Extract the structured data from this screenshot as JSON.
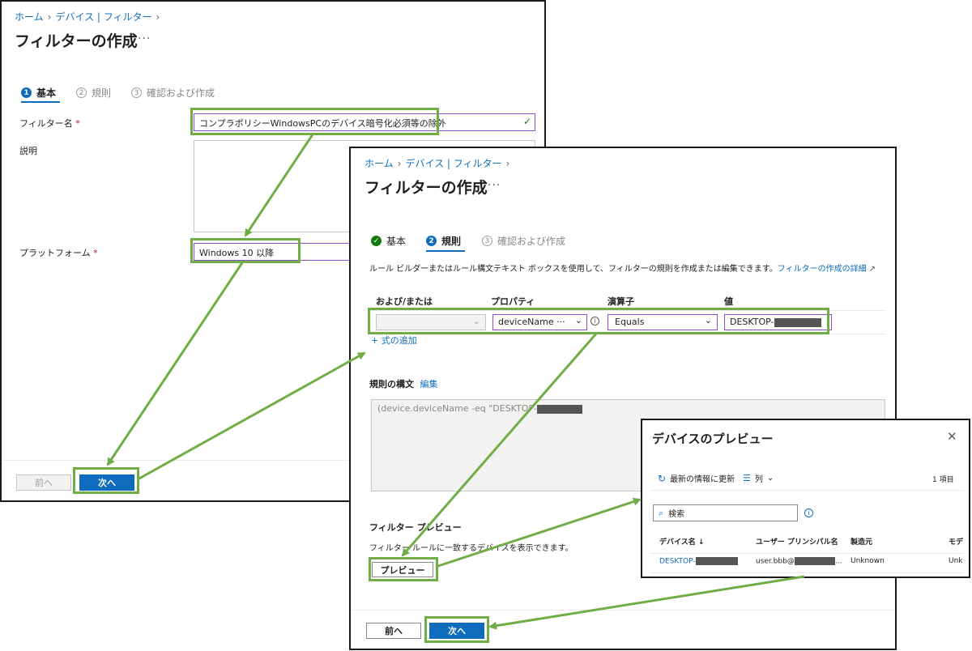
{
  "form1": {
    "breadcrumb": [
      "ホーム",
      "デバイス | フィルター"
    ],
    "title": "フィルターの作成",
    "more": "···",
    "steps": [
      {
        "num": "1",
        "label": "基本"
      },
      {
        "num": "2",
        "label": "規則"
      },
      {
        "num": "3",
        "label": "確認および作成"
      }
    ],
    "filter_name_label": "フィルター名",
    "required_mark": "*",
    "filter_name_value": "コンプラポリシーWindowsPCのデバイス暗号化必須等の除外",
    "description_label": "説明",
    "platform_label": "プラットフォーム",
    "platform_value": "Windows 10 以降",
    "prev_label": "前へ",
    "next_label": "次へ"
  },
  "form2": {
    "breadcrumb": [
      "ホーム",
      "デバイス | フィルター"
    ],
    "title": "フィルターの作成",
    "more": "···",
    "steps": [
      {
        "num": "✓",
        "label": "基本"
      },
      {
        "num": "2",
        "label": "規則"
      },
      {
        "num": "3",
        "label": "確認および作成"
      }
    ],
    "intro_text": "ルール ビルダーまたはルール構文テキスト ボックスを使用して、フィルターの規則を作成または編集できます。",
    "intro_link": "フィルターの作成の詳細",
    "columns": [
      "および/または",
      "プロパティ",
      "演算子",
      "値"
    ],
    "row": {
      "andor": "",
      "property": "deviceName ···",
      "operator": "Equals",
      "value": "DESKTOP-"
    },
    "add_expression": "+ 式の追加",
    "syntax_title": "規則の構文",
    "syntax_edit": "編集",
    "syntax_text": "(device.deviceName -eq \"DESKTOP-",
    "preview_title": "フィルター プレビュー",
    "preview_desc": "フィルター ルールに一致するデバイスを表示できます。",
    "preview_button": "プレビュー",
    "prev_label": "前へ",
    "next_label": "次へ"
  },
  "preview_panel": {
    "title": "デバイスのプレビュー",
    "refresh": "最新の情報に更新",
    "columns_btn": "列",
    "count": "1 項目",
    "search_placeholder": "検索",
    "headers": [
      "デバイス名 ↓",
      "ユーザー プリンシパル名",
      "製造元",
      "モデ"
    ],
    "rows": [
      {
        "device": "DESKTOP-",
        "upn": "user.bbb@",
        "upn_tail": "...",
        "maker": "Unknown",
        "model": "Unk"
      }
    ]
  },
  "colors": {
    "accent": "#0f6cbd",
    "highlight_green": "#70ad47",
    "required_red": "#a4262c",
    "input_border_purple": "#8e4fc6",
    "success_green": "#107c10"
  }
}
